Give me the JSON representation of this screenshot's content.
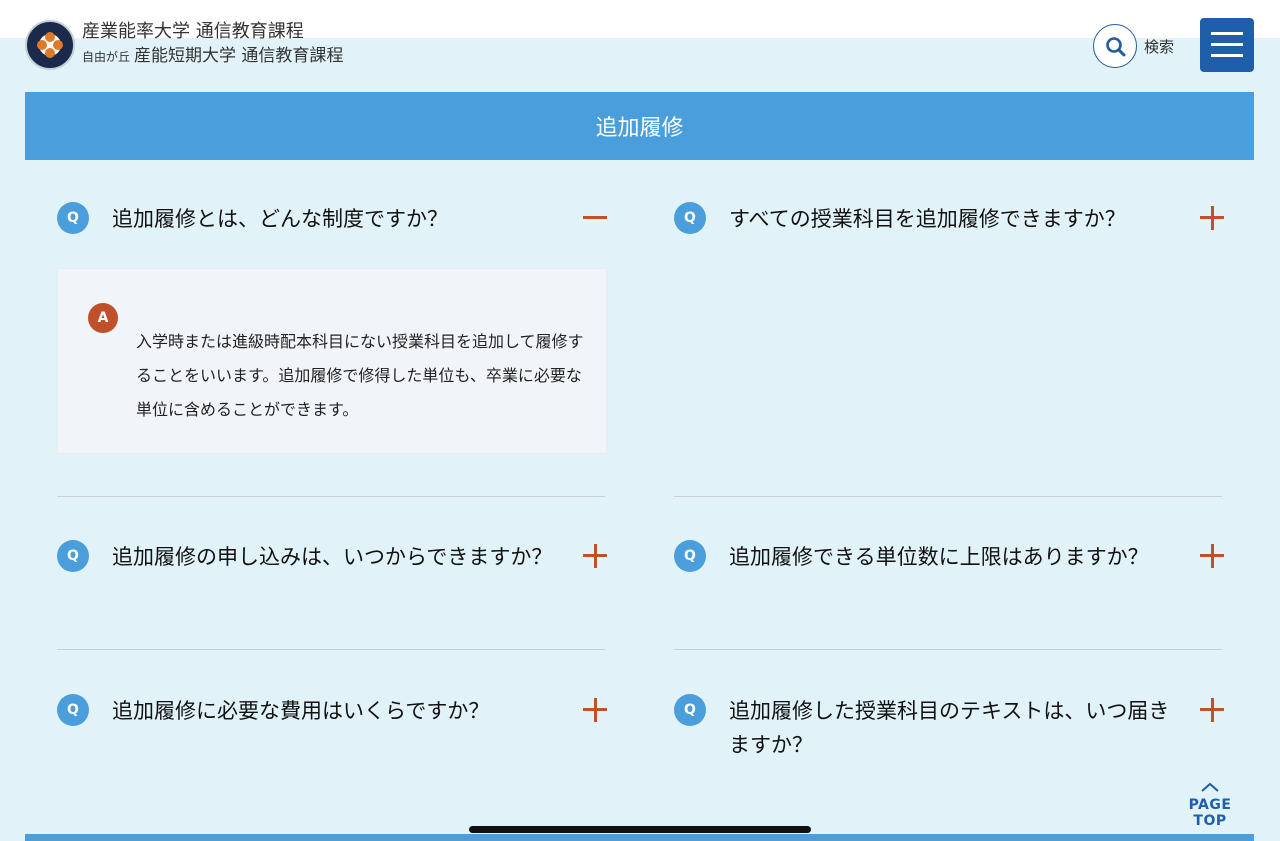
{
  "header": {
    "brand_line1": "産業能率大学 通信教育課程",
    "brand_line2_small": "自由が丘",
    "brand_line2": "産能短期大学 通信教育課程",
    "search_label": "検索"
  },
  "section": {
    "title": "追加履修"
  },
  "faq": {
    "q_badge": "Q",
    "a_badge": "A",
    "items": [
      {
        "question": "追加履修とは、どんな制度ですか？",
        "expanded": true,
        "answer": "入学時または進級時配本科目にない授業科目を追加して履修することをいいます。追加履修で修得した単位も、卒業に必要な単位に含めることができます。"
      },
      {
        "question": "すべての授業科目を追加履修できますか？",
        "expanded": false
      },
      {
        "question": "追加履修の申し込みは、いつからできますか？",
        "expanded": false
      },
      {
        "question": "追加履修できる単位数に上限はありますか？",
        "expanded": false
      },
      {
        "question": "追加履修に必要な費用はいくらですか？",
        "expanded": false
      },
      {
        "question": "追加履修した授業科目のテキストは、いつ届きますか？",
        "expanded": false
      }
    ]
  },
  "page_top": {
    "label": "PAGE TOP"
  },
  "colors": {
    "accent_blue": "#4a9edb",
    "navy": "#1f5ea8",
    "toggle_red": "#c0502a",
    "background": "#e1f3f8"
  }
}
